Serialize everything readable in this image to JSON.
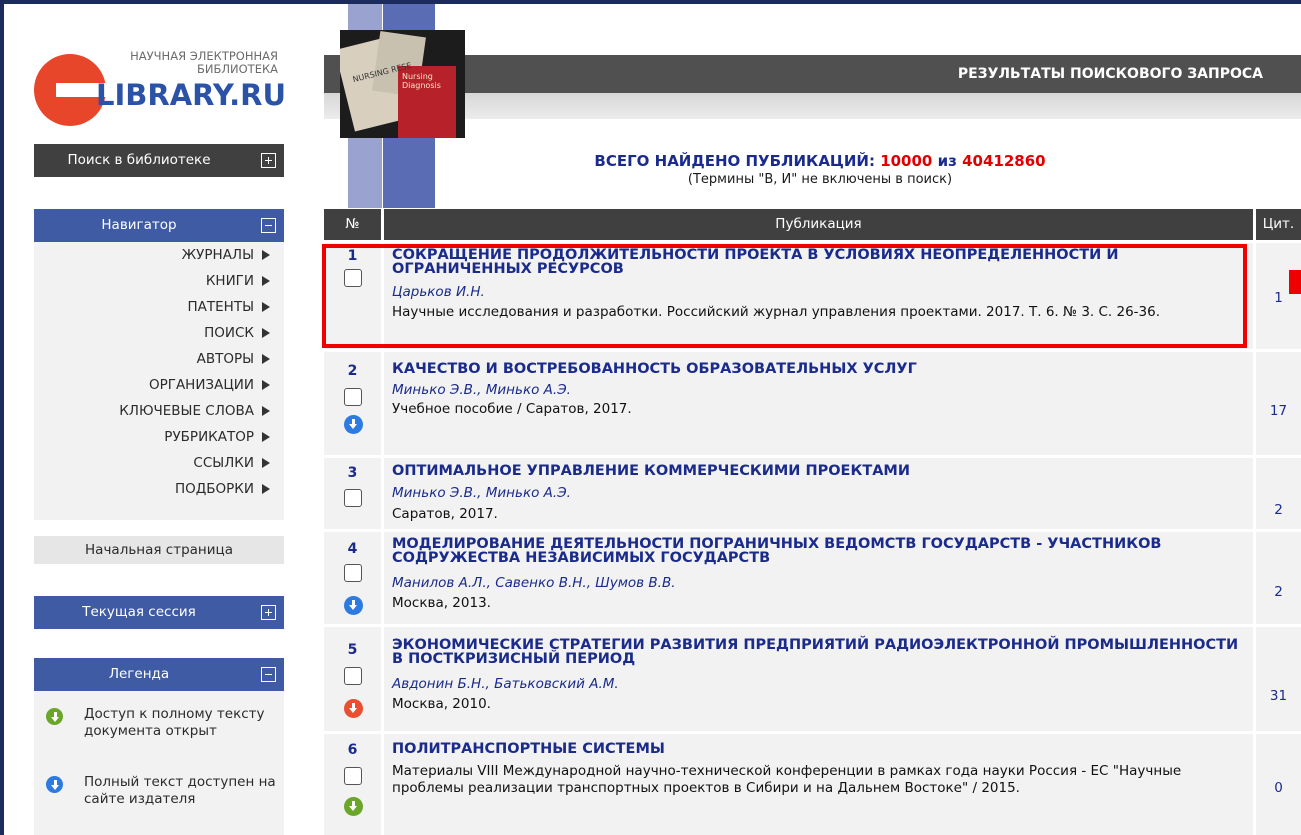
{
  "logo": {
    "line1": "НАУЧНАЯ ЭЛЕКТРОННАЯ",
    "line2": "БИБЛИОТЕКА",
    "brand": "LIBRARY.RU"
  },
  "sidebar": {
    "search_label": "Поиск в библиотеке",
    "navigator_label": "Навигатор",
    "nav_items": [
      "ЖУРНАЛЫ",
      "КНИГИ",
      "ПАТЕНТЫ",
      "ПОИСК",
      "АВТОРЫ",
      "ОРГАНИЗАЦИИ",
      "КЛЮЧЕВЫЕ СЛОВА",
      "РУБРИКАТОР",
      "ССЫЛКИ",
      "ПОДБОРКИ"
    ],
    "home_label": "Начальная страница",
    "session_label": "Текущая сессия",
    "legend_label": "Легенда",
    "legend_items": [
      {
        "icon": "download-green-icon",
        "text": "Доступ к полному тексту документа открыт"
      },
      {
        "icon": "download-blue-icon",
        "text": "Полный текст доступен на сайте издателя"
      }
    ]
  },
  "header": {
    "title": "РЕЗУЛЬТАТЫ ПОИСКОВОГО ЗАПРОСА",
    "photo_text_a": "Nursing Diagnosis",
    "photo_text_b": "NURSING RESE"
  },
  "summary": {
    "found_label": "ВСЕГО НАЙДЕНО ПУБЛИКАЦИЙ:",
    "found": "10000",
    "of": "из",
    "total": "40412860",
    "note": "(Термины \"В, И\" не включены в поиск)"
  },
  "table": {
    "headers": [
      "№",
      "Публикация",
      "Цит."
    ],
    "rows": [
      {
        "num": "1",
        "title": "СОКРАЩЕНИЕ ПРОДОЛЖИТЕЛЬНОСТИ ПРОЕКТА В УСЛОВИЯХ НЕОПРЕДЕЛЕННОСТИ И ОГРАНИЧЕННЫХ РЕСУРСОВ",
        "authors": "Царьков И.Н.",
        "source": "Научные исследования и разработки. Российский журнал управления проектами. 2017. Т. 6. № 3. С. 26-36.",
        "cit": "1",
        "download": ""
      },
      {
        "num": "2",
        "title": "КАЧЕСТВО И ВОСТРЕБОВАННОСТЬ ОБРАЗОВАТЕЛЬНЫХ УСЛУГ",
        "authors": "Минько Э.В., Минько А.Э.",
        "source": "Учебное пособие / Саратов, 2017.",
        "cit": "17",
        "download": "blue"
      },
      {
        "num": "3",
        "title": "ОПТИМАЛЬНОЕ УПРАВЛЕНИЕ КОММЕРЧЕСКИМИ ПРОЕКТАМИ",
        "authors": "Минько Э.В., Минько А.Э.",
        "source": "Саратов, 2017.",
        "cit": "2",
        "download": ""
      },
      {
        "num": "4",
        "title": "МОДЕЛИРОВАНИЕ ДЕЯТЕЛЬНОСТИ ПОГРАНИЧНЫХ ВЕДОМСТВ ГОСУДАРСТВ - УЧАСТНИКОВ СОДРУЖЕСТВА НЕЗАВИСИМЫХ ГОСУДАРСТВ",
        "authors": "Манилов А.Л., Савенко В.Н., Шумов В.В.",
        "source": "Москва, 2013.",
        "cit": "2",
        "download": "blue"
      },
      {
        "num": "5",
        "title": "ЭКОНОМИЧЕСКИЕ СТРАТЕГИИ РАЗВИТИЯ ПРЕДПРИЯТИЙ РАДИОЭЛЕКТРОННОЙ ПРОМЫШЛЕННОСТИ В ПОСТКРИЗИСНЫЙ ПЕРИОД",
        "authors": "Авдонин Б.Н., Батьковский А.М.",
        "source": "Москва, 2010.",
        "cit": "31",
        "download": "red"
      },
      {
        "num": "6",
        "title": "ПОЛИТРАНСПОРТНЫЕ СИСТЕМЫ",
        "authors": "",
        "source": "Материалы VIII Международной научно-технической конференции в рамках года науки Россия - ЕС \"Научные проблемы реализации транспортных проектов в Сибири и на Дальнем Востоке\" / 2015.",
        "cit": "0",
        "download": "green"
      }
    ]
  },
  "colors": {
    "accent_navy": "#1a2b8c",
    "highlight_red": "#f00000",
    "header_dark": "#404040",
    "navigator_blue": "#3e5ba3"
  }
}
